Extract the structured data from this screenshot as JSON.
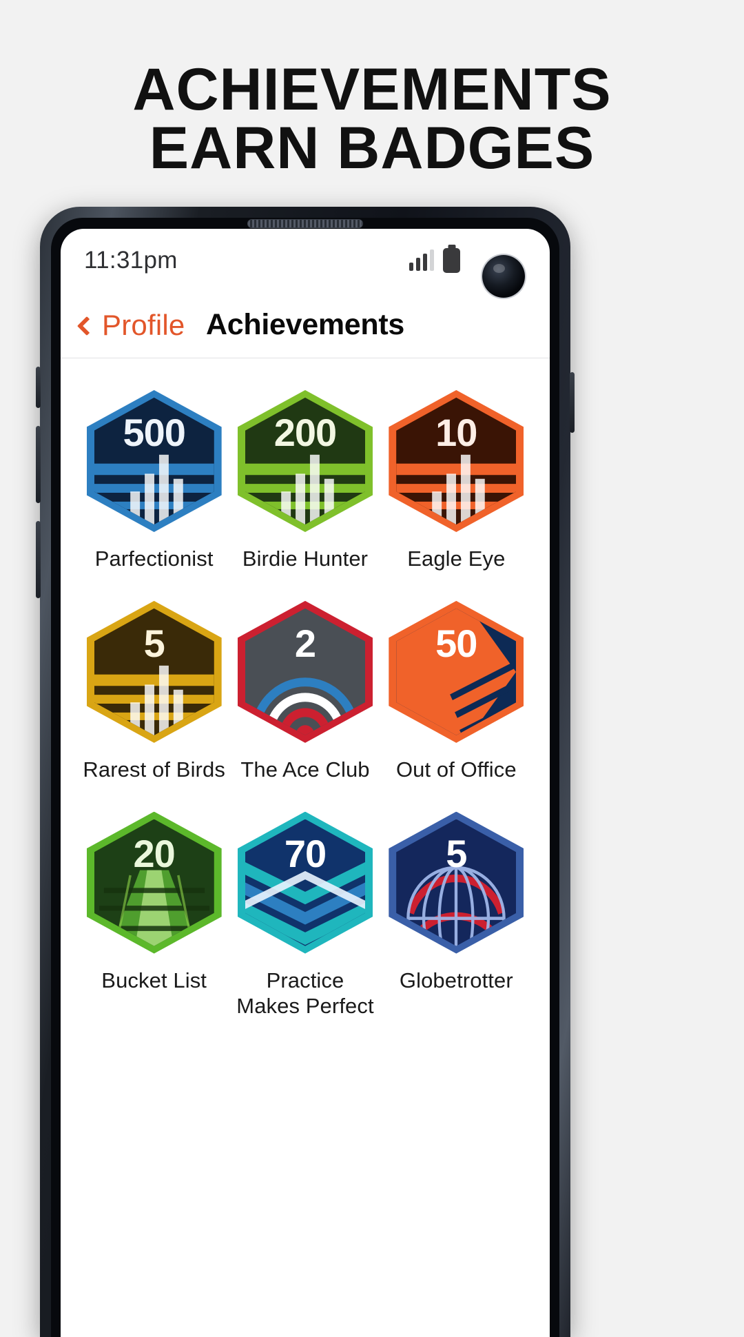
{
  "promo": {
    "headline_line1": "ACHIEVEMENTS",
    "headline_line2": "EARN BADGES",
    "background_color": "#f2f2f2",
    "text_color": "#111111"
  },
  "phone": {
    "frame_color": "#1a1e24",
    "camera_icon": "front-camera-punch-hole",
    "earpiece_icon": "earpiece-speaker"
  },
  "statusbar": {
    "time": "11:31pm",
    "signal_icon": "cellular-signal-bars",
    "signal_bars_total": 4,
    "signal_bars_active": 3,
    "battery_icon": "battery-full"
  },
  "navbar": {
    "back_icon": "chevron-left-icon",
    "back_label": "Profile",
    "title": "Achievements",
    "accent_color": "#e2562a",
    "title_color": "#0a0a0a"
  },
  "badges": [
    {
      "number": "500",
      "label": "Parfectionist",
      "art": "bar-chart-stripes",
      "border_color": "#2d7fc1",
      "fill_color": "#0d2340",
      "accent_color": "#2d7fc1",
      "number_color": "#eef4fb"
    },
    {
      "number": "200",
      "label": "Birdie Hunter",
      "art": "bar-chart-stripes",
      "border_color": "#7fc02b",
      "fill_color": "#203913",
      "accent_color": "#7fc02b",
      "number_color": "#f2f7e2"
    },
    {
      "number": "10",
      "label": "Eagle Eye",
      "art": "bar-chart-stripes",
      "border_color": "#f0622a",
      "fill_color": "#3a1405",
      "accent_color": "#f0622a",
      "number_color": "#fdeee6"
    },
    {
      "number": "5",
      "label": "Rarest of Birds",
      "art": "bar-chart-stripes",
      "border_color": "#d9a514",
      "fill_color": "#3a2a08",
      "accent_color": "#d9a514",
      "number_color": "#fdf4dc"
    },
    {
      "number": "2",
      "label": "The Ace Club",
      "art": "target-rings",
      "border_color": "#cc2030",
      "fill_color": "#4a4f55",
      "accent_color": "#cc2030",
      "number_color": "#ffffff"
    },
    {
      "number": "50",
      "label": "Out of Office",
      "art": "diagonal-stripes-arrow",
      "border_color": "#f0622a",
      "fill_color": "#0d2a55",
      "accent_color": "#1fb6bd",
      "number_color": "#ffffff"
    },
    {
      "number": "20",
      "label": "Bucket List",
      "art": "fairway-perspective",
      "border_color": "#5cb82b",
      "fill_color": "#1d4016",
      "accent_color": "#8fd44a",
      "number_color": "#eaf7dc"
    },
    {
      "number": "70",
      "label": "Practice\nMakes Perfect",
      "art": "chevron-stripes",
      "border_color": "#1fb6bd",
      "fill_color": "#10336b",
      "accent_color": "#1fb6bd",
      "number_color": "#ffffff"
    },
    {
      "number": "5",
      "label": "Globetrotter",
      "art": "globe-grid",
      "border_color": "#3a5fa8",
      "fill_color": "#14275c",
      "accent_color": "#cc2030",
      "number_color": "#ffffff"
    }
  ]
}
